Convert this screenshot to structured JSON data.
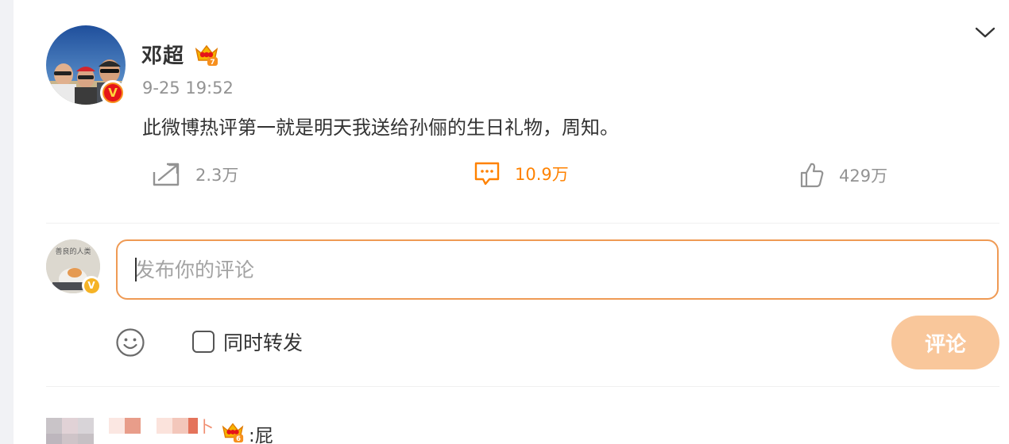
{
  "post": {
    "author": "邓超",
    "time": "9-25 19:52",
    "text": "此微博热评第一就是明天我送给孙俪的生日礼物，周知。",
    "verified_icon": "verified-v-badge",
    "member_icon": "crown-icon",
    "member_level": "7"
  },
  "actions": {
    "share_count": "2.3万",
    "comment_count": "10.9万",
    "like_count": "429万"
  },
  "compose": {
    "placeholder": "发布你的评论",
    "repost_label": "同时转发",
    "repost_checked": false,
    "submit_label": "评论",
    "avatar_caption": "善良的人类"
  },
  "first_comment": {
    "name_visible": "卜",
    "member_level": "6",
    "text": ":屁"
  },
  "colors": {
    "accent": "#ff8200",
    "input_border": "#ef9a54",
    "submit_disabled": "#f9c79b",
    "muted_text": "#939393"
  }
}
